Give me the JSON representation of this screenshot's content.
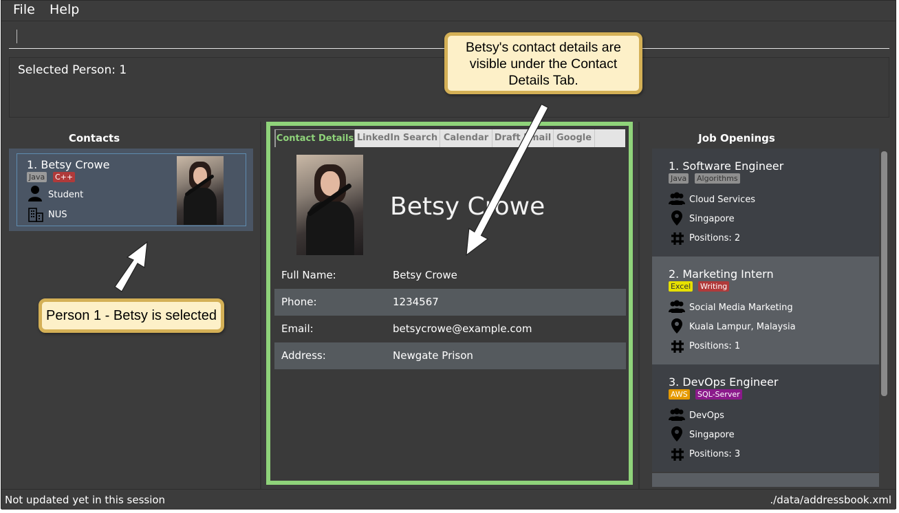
{
  "menu": {
    "file": "File",
    "help": "Help"
  },
  "command": {
    "value": ""
  },
  "result": {
    "text": "Selected Person: 1"
  },
  "contacts": {
    "title": "Contacts",
    "items": [
      {
        "name": "1.  Betsy Crowe",
        "tags": [
          "Java",
          "C++"
        ],
        "occupation": "Student",
        "organization": "NUS"
      }
    ]
  },
  "tabs": [
    "Contact Details",
    "LinkedIn Search",
    "Calendar",
    "Draft Email",
    "Google"
  ],
  "details": {
    "name": "Betsy Crowe",
    "rows": [
      {
        "label": "Full Name:",
        "value": "Betsy Crowe"
      },
      {
        "label": "Phone:",
        "value": "1234567"
      },
      {
        "label": "Email:",
        "value": "betsycrowe@example.com"
      },
      {
        "label": "Address:",
        "value": "Newgate Prison"
      }
    ]
  },
  "jobs": {
    "title": "Job Openings",
    "items": [
      {
        "title": "1.  Software Engineer",
        "tags": [
          "Java",
          "Algorithms"
        ],
        "team": "Cloud Services",
        "location": "Singapore",
        "positions": "Positions: 2"
      },
      {
        "title": "2.  Marketing Intern",
        "tags": [
          "Excel",
          "Writing"
        ],
        "team": "Social Media Marketing",
        "location": "Kuala Lampur, Malaysia",
        "positions": "Positions: 1"
      },
      {
        "title": "3.  DevOps Engineer",
        "tags": [
          "AWS",
          "SQL-Server"
        ],
        "team": "DevOps",
        "location": "Singapore",
        "positions": "Positions: 3"
      }
    ]
  },
  "status": {
    "left": "Not updated yet in this session",
    "right": "./data/addressbook.xml"
  },
  "annotations": {
    "top": "Betsy's contact details are visible under the Contact Details Tab.",
    "bottom": "Person 1 - Betsy is selected"
  },
  "colors": {
    "accent_green": "#8fd37a",
    "callout_fill": "#fdf0c8",
    "callout_border": "#d4b056",
    "selected_card": "#4a5564"
  }
}
